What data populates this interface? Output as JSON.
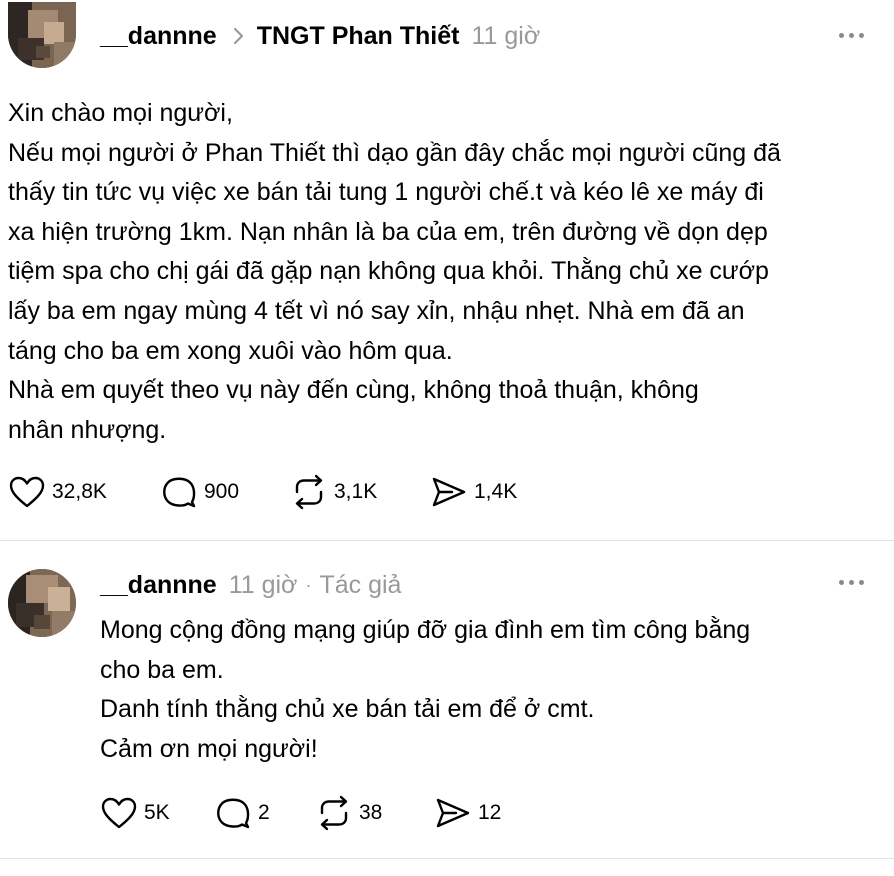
{
  "post": {
    "username": "__dannne",
    "group": "TNGT Phan Thiết",
    "time": "11 giờ",
    "lines": [
      "Xin chào mọi người,",
      "Nếu mọi người ở Phan Thiết thì dạo gần đây chắc mọi người cũng đã",
      "thấy tin tức vụ việc xe bán tải tung 1 người chế.t và kéo lê xe máy đi",
      "xa hiện trường 1km. Nạn nhân là ba của em, trên đường về dọn dẹp",
      "tiệm spa cho chị gái đã gặp nạn không qua khỏi. Thằng chủ xe cướp",
      "lấy ba em ngay mùng 4 tết vì nó say xỉn, nhậu nhẹt. Nhà em đã an",
      "táng cho ba em xong xuôi vào hôm qua.",
      "Nhà em quyết theo vụ này đến cùng, không thoả thuận, không",
      "nhân nhượng."
    ],
    "likes": "32,8K",
    "replies": "900",
    "reposts": "3,1K",
    "shares": "1,4K"
  },
  "reply": {
    "username": "__dannne",
    "time": "11 giờ",
    "separator": "·",
    "role": "Tác giả",
    "lines": [
      "Mong cộng đồng mạng giúp đỡ gia đình em tìm công bằng",
      "cho ba em.",
      "Danh tính thằng chủ xe bán tải em để ở cmt.",
      "Cảm ơn mọi người!"
    ],
    "likes": "5K",
    "replies": "2",
    "reposts": "38",
    "shares": "12"
  },
  "icons": {
    "like": "heart-icon",
    "reply": "speech-bubble-icon",
    "repost": "repost-icon",
    "share": "send-icon",
    "more": "more-dots-icon",
    "chevron": "chevron-right-icon"
  },
  "colors": {
    "text": "#000000",
    "muted": "#999999",
    "divider": "#e3e3e3"
  }
}
